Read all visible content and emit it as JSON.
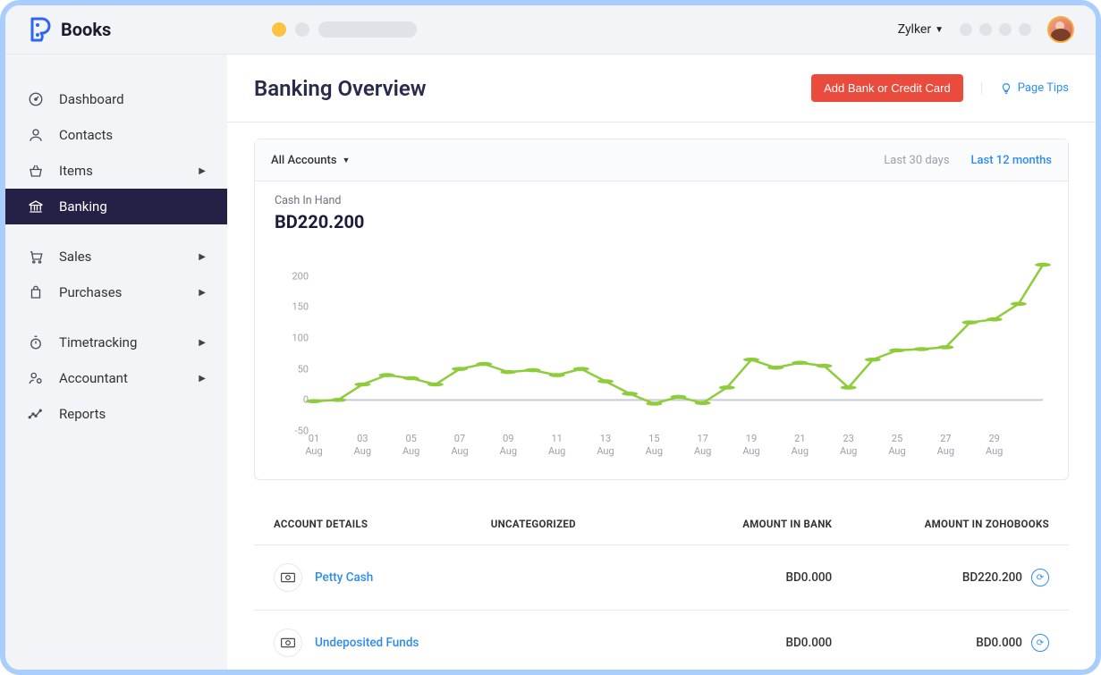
{
  "app": {
    "name": "Books"
  },
  "topbar": {
    "org": "Zylker"
  },
  "sidebar": {
    "items": [
      {
        "key": "dashboard",
        "label": "Dashboard",
        "icon": "gauge",
        "expand": false,
        "sep": false
      },
      {
        "key": "contacts",
        "label": "Contacts",
        "icon": "person",
        "expand": false,
        "sep": false
      },
      {
        "key": "items",
        "label": "Items",
        "icon": "basket",
        "expand": true,
        "sep": false
      },
      {
        "key": "banking",
        "label": "Banking",
        "icon": "bank",
        "expand": false,
        "active": true,
        "sep": false
      },
      {
        "key": "sales",
        "label": "Sales",
        "icon": "cart",
        "expand": true,
        "sep": true
      },
      {
        "key": "purchases",
        "label": "Purchases",
        "icon": "bag",
        "expand": true,
        "sep": false
      },
      {
        "key": "timetracking",
        "label": "Timetracking",
        "icon": "stopwatch",
        "expand": true,
        "sep": true
      },
      {
        "key": "accountant",
        "label": "Accountant",
        "icon": "person-cog",
        "expand": true,
        "sep": false
      },
      {
        "key": "reports",
        "label": "Reports",
        "icon": "trend",
        "expand": false,
        "sep": false
      }
    ]
  },
  "page": {
    "title": "Banking Overview",
    "add_button": "Add Bank or Credit Card",
    "page_tips": "Page Tips"
  },
  "card": {
    "filter_label": "All Accounts",
    "range_30": "Last 30 days",
    "range_12": "Last 12 months",
    "active_range": "12",
    "cash_label": "Cash In Hand",
    "cash_value": "BD220.200"
  },
  "chart_data": {
    "type": "line",
    "title": "Cash In Hand",
    "xlabel": "",
    "ylabel": "",
    "ylim": [
      -50,
      250
    ],
    "y_ticks": [
      -50,
      0,
      50,
      100,
      150,
      200
    ],
    "x_labels": [
      "01\nAug",
      "03\nAug",
      "05\nAug",
      "07\nAug",
      "09\nAug",
      "11\nAug",
      "13\nAug",
      "15\nAug",
      "17\nAug",
      "19\nAug",
      "21\nAug",
      "23\nAug",
      "25\nAug",
      "27\nAug",
      "29\nAug"
    ],
    "x": [
      1,
      2,
      3,
      4,
      5,
      6,
      7,
      8,
      9,
      10,
      11,
      12,
      13,
      14,
      15,
      16,
      17,
      18,
      19,
      20,
      21,
      22,
      23,
      24,
      25,
      26,
      27,
      28,
      29,
      30
    ],
    "values": [
      -2,
      0,
      25,
      40,
      35,
      25,
      50,
      58,
      45,
      48,
      40,
      50,
      30,
      10,
      -6,
      5,
      -5,
      20,
      65,
      52,
      60,
      55,
      20,
      65,
      80,
      82,
      85,
      125,
      130,
      155,
      218
    ],
    "color": "#8ecc3b"
  },
  "table": {
    "headers": {
      "account": "ACCOUNT DETAILS",
      "uncat": "UNCATEGORIZED",
      "bank": "AMOUNT IN BANK",
      "zoho": "AMOUNT IN ZOHOBOOKS"
    },
    "rows": [
      {
        "name": "Petty Cash",
        "uncat": "",
        "bank": "BD0.000",
        "zoho": "BD220.200"
      },
      {
        "name": "Undeposited Funds",
        "uncat": "",
        "bank": "BD0.000",
        "zoho": "BD0.000"
      }
    ]
  }
}
